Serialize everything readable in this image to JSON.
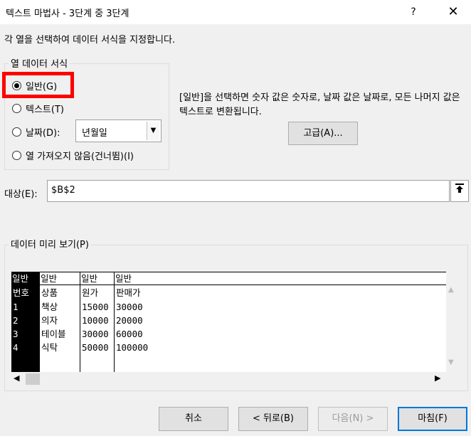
{
  "window": {
    "title": "텍스트 마법사 - 3단계 중 3단계",
    "help_label": "?",
    "close_label": "✕"
  },
  "instruction": "각 열을 선택하여 데이터 서식을 지정합니다.",
  "column_format": {
    "title": "열 데이터 서식",
    "options": [
      {
        "label": "일반(G)",
        "checked": true
      },
      {
        "label": "텍스트(T)",
        "checked": false
      },
      {
        "label": "날짜(D):",
        "checked": false
      },
      {
        "label": "열 가져오지 않음(건너뜀)(I)",
        "checked": false
      }
    ],
    "date_format_value": "년월일"
  },
  "description": "[일반]을 선택하면 숫자 값은 숫자로, 날짜 값은 날짜로, 모든 나머지 값은 텍스트로 변환됩니다.",
  "advanced_button": "고급(A)...",
  "destination": {
    "label": "대상(E):",
    "value": "$B$2",
    "button_icon": "collapse-dialog-icon"
  },
  "preview": {
    "title": "데이터 미리 보기(P)",
    "headers": [
      "일반",
      "일반",
      "일반",
      "일반"
    ],
    "columns": [
      [
        "번호",
        "1",
        "2",
        "3",
        "4"
      ],
      [
        "상품",
        "책상",
        "의자",
        "테이블",
        "식탁"
      ],
      [
        "원가",
        "15000",
        "10000",
        "30000",
        "50000"
      ],
      [
        "판매가",
        "30000",
        "20000",
        "60000",
        "100000"
      ]
    ]
  },
  "buttons": {
    "cancel": "취소",
    "back": "< 뒤로(B)",
    "next": "다음(N) >",
    "finish": "마침(F)"
  }
}
